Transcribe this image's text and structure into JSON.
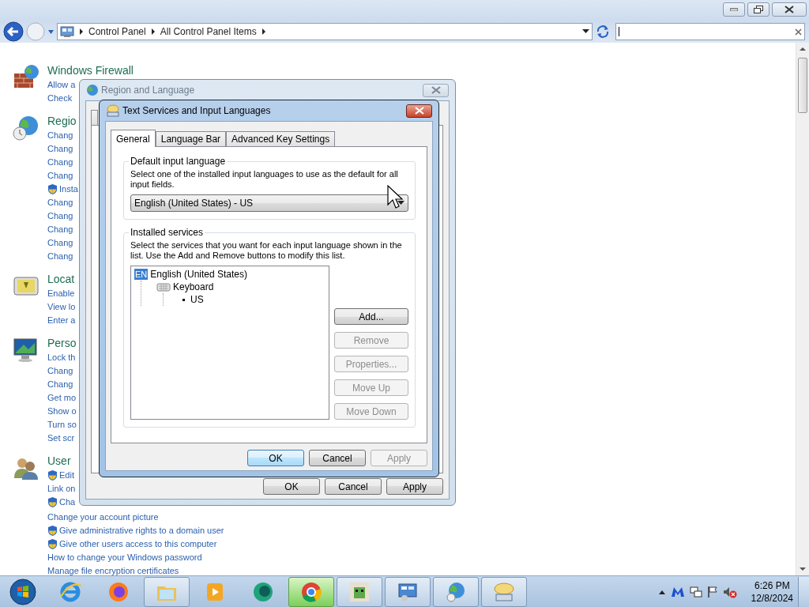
{
  "explorer": {
    "nav": {
      "back_disabled": false,
      "forward_disabled": true
    },
    "breadcrumb": [
      "Control Panel",
      "All Control Panel Items"
    ]
  },
  "categories": [
    {
      "title": "Windows Firewall",
      "kind": "firewall",
      "links": [
        {
          "text": "Allow a",
          "shield": false
        },
        {
          "text": "Check",
          "shield": false
        }
      ]
    },
    {
      "title": "Regio",
      "kind": "region",
      "links": [
        {
          "text": "Chang",
          "shield": false
        },
        {
          "text": "Chang",
          "shield": false
        },
        {
          "text": "Chang",
          "shield": false
        },
        {
          "text": "Chang",
          "shield": false
        },
        {
          "text": "Insta",
          "shield": true
        },
        {
          "text": "Chang",
          "shield": false
        },
        {
          "text": "Chang",
          "shield": false
        },
        {
          "text": "Chang",
          "shield": false
        },
        {
          "text": "Chang",
          "shield": false
        },
        {
          "text": "Chang",
          "shield": false
        }
      ]
    },
    {
      "title": "Locat",
      "kind": "location",
      "links": [
        {
          "text": "Enable",
          "shield": false
        },
        {
          "text": "View lo",
          "shield": false
        },
        {
          "text": "Enter a",
          "shield": false
        }
      ]
    },
    {
      "title": "Perso",
      "kind": "display",
      "links": [
        {
          "text": "Lock th",
          "shield": false
        },
        {
          "text": "Chang",
          "shield": false
        },
        {
          "text": "Chang",
          "shield": false
        },
        {
          "text": "Get mo",
          "shield": false
        },
        {
          "text": "Show o",
          "shield": false
        },
        {
          "text": "Turn so",
          "shield": false
        },
        {
          "text": "Set scr",
          "shield": false
        }
      ]
    },
    {
      "title": "User",
      "kind": "users",
      "links": [
        {
          "text": "Edit",
          "shield": true
        },
        {
          "text": "Link on",
          "shield": false
        },
        {
          "text": "Cha",
          "shield": true
        },
        {
          "text": "Change your account picture",
          "shield": false
        },
        {
          "text": "Give administrative rights to a domain user",
          "shield": true
        },
        {
          "text": "Give other users access to this computer",
          "shield": true
        },
        {
          "text": "How to change your Windows password",
          "shield": false
        },
        {
          "text": "Manage file encryption certificates",
          "shield": false
        }
      ]
    }
  ],
  "region_dialog": {
    "title": "Region and Language",
    "active": false,
    "buttons": [
      {
        "label": "OK",
        "disabled": false,
        "default": false
      },
      {
        "label": "Cancel",
        "disabled": false,
        "default": false
      },
      {
        "label": "Apply",
        "disabled": false,
        "default": false
      }
    ]
  },
  "text_services": {
    "title": "Text Services and Input Languages",
    "active": true,
    "tabs": [
      {
        "label": "General",
        "selected": true
      },
      {
        "label": "Language Bar",
        "selected": false
      },
      {
        "label": "Advanced Key Settings",
        "selected": false
      }
    ],
    "default_group": {
      "title": "Default input language",
      "description": "Select one of the installed input languages to use as the default for all input fields.",
      "value": "English (United States) - US"
    },
    "services_group": {
      "title": "Installed services",
      "description": "Select the services that you want for each input language shown in the list. Use the Add and Remove buttons to modify this list.",
      "tree": [
        {
          "label": "English (United States)",
          "kind": "language",
          "badge": "EN",
          "children": [
            {
              "label": "Keyboard",
              "kind": "category",
              "children": [
                {
                  "label": "US",
                  "kind": "layout"
                }
              ]
            }
          ]
        }
      ]
    },
    "side_buttons": [
      {
        "label": "Add...",
        "disabled": false
      },
      {
        "label": "Remove",
        "disabled": true
      },
      {
        "label": "Properties...",
        "disabled": true
      },
      {
        "label": "Move Up",
        "disabled": true
      },
      {
        "label": "Move Down",
        "disabled": true
      }
    ],
    "footer_buttons": [
      {
        "label": "OK",
        "disabled": false,
        "default": true
      },
      {
        "label": "Cancel",
        "disabled": false,
        "default": false
      },
      {
        "label": "Apply",
        "disabled": true,
        "default": false
      }
    ]
  },
  "taskbar": {
    "apps": [
      {
        "kind": "ie",
        "open": false,
        "active": false
      },
      {
        "kind": "firefox",
        "open": false,
        "active": false
      },
      {
        "kind": "folder",
        "open": true,
        "active": false
      },
      {
        "kind": "media",
        "open": false,
        "active": false
      },
      {
        "kind": "green",
        "open": false,
        "active": false
      },
      {
        "kind": "chrome",
        "open": true,
        "active": true
      },
      {
        "kind": "block",
        "open": true,
        "active": false
      },
      {
        "kind": "panel",
        "open": true,
        "active": false
      },
      {
        "kind": "globe",
        "open": true,
        "active": false
      },
      {
        "kind": "keyboard",
        "open": true,
        "active": false
      }
    ],
    "clock": {
      "time": "6:26 PM",
      "date": "12/8/2024"
    }
  }
}
